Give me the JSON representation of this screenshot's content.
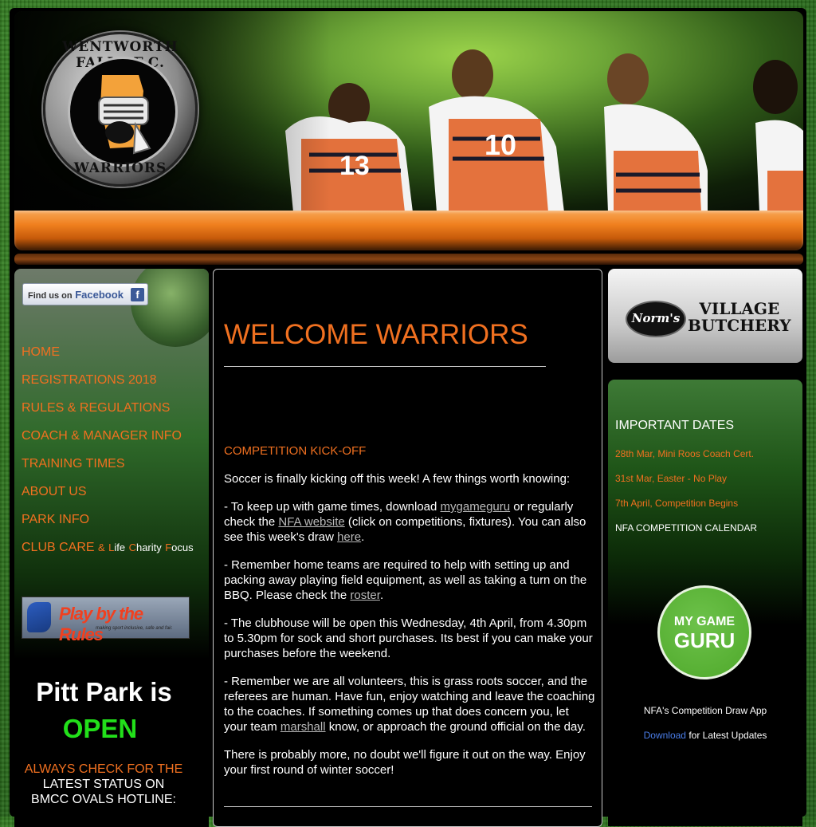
{
  "header": {
    "logo_top": "WENTWORTH FALLS F.C.",
    "logo_bottom": "WARRIORS",
    "players": [
      "13",
      "10"
    ]
  },
  "left": {
    "facebook": {
      "small": "Find us on",
      "brand": "Facebook"
    },
    "nav": [
      {
        "label": "HOME"
      },
      {
        "label": "REGISTRATIONS 2018"
      },
      {
        "label": "RULES & REGULATIONS"
      },
      {
        "label": "COACH & MANAGER INFO"
      },
      {
        "label": "TRAINING TIMES"
      },
      {
        "label": "ABOUT US"
      },
      {
        "label": "PARK INFO"
      }
    ],
    "club_care": {
      "main": "CLUB CARE",
      "amp": "&",
      "l1": "L",
      "l2": "ife",
      "c1": "C",
      "c2": "harity",
      "f1": "F",
      "f2": "ocus"
    },
    "play_banner": {
      "title": "Play by the Rules",
      "tagline": "making sport inclusive, safe and fair."
    },
    "pitt": "Pitt Park is",
    "open": "OPEN",
    "always": "ALWAYS CHECK FOR THE",
    "always2": "LATEST STATUS ON",
    "always3": "BMCC OVALS HOTLINE:"
  },
  "main": {
    "title": "WELCOME WARRIORS",
    "kickoff": "COMPETITION KICK-OFF",
    "p1": "Soccer is finally kicking off this week! A few things worth knowing:",
    "p2a": "- To keep up with game times, download ",
    "p2_link1": "mygameguru",
    "p2b": " or regularly check the ",
    "p2_link2": "NFA website",
    "p2c": " (click on competitions, fixtures). You can also see this week's draw ",
    "p2_link3": "here",
    "p2d": ".",
    "p3a": "- Remember home teams are required to help with setting up and packing away playing field equipment, as well as taking a turn on the BBQ. Please check the ",
    "p3_link": "roster",
    "p3b": ".",
    "p4": "- The clubhouse will be open this Wednesday, 4th April, from 4.30pm to 5.30pm for sock and short purchases. Its best if you can make your purchases before the weekend.",
    "p5a": "- Remember we are all volunteers, this is grass roots soccer, and the referees are human. Have fun, enjoy watching and leave the coaching to the coaches. If something comes up that does concern you, let your team ",
    "p5_link": "marshall",
    "p5b": " know, or approach the ground official on the day.",
    "p6": "There is probably more, no doubt we'll figure it out on the way. Enjoy your first round of winter soccer!"
  },
  "right": {
    "sponsor_norms": "Norm's",
    "sponsor_village": "VILLAGE",
    "sponsor_butchery": "BUTCHERY",
    "dates_title": "IMPORTANT DATES",
    "dates": [
      "28th Mar, Mini Roos Coach Cert.",
      "31st Mar, Easter - No Play",
      "7th April, Competition Begins"
    ],
    "calendar": "NFA COMPETITION CALENDAR",
    "guru_line1": "MY GAME",
    "guru_line2": "GURU",
    "app_text": "NFA's Competition Draw App",
    "download_link": "Download",
    "download_rest": " for Latest Updates"
  }
}
